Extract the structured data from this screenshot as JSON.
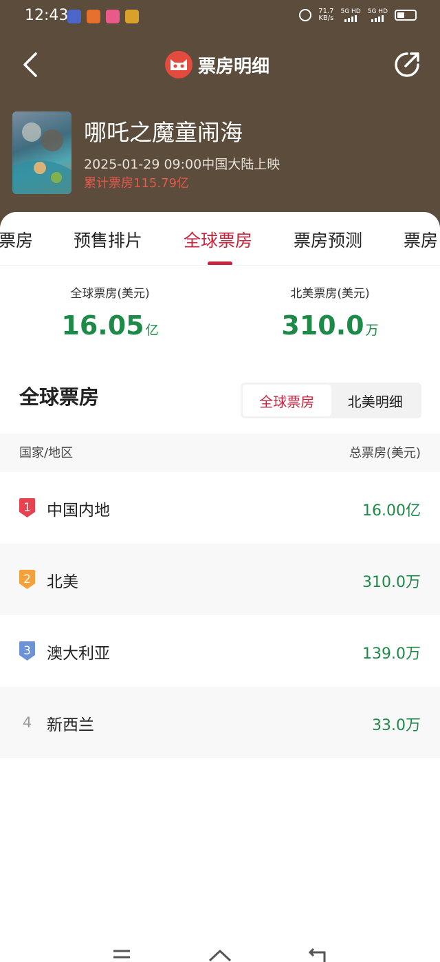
{
  "status_bar": {
    "time": "12:43",
    "net_speed": "71.7",
    "net_unit": "KB/s",
    "sim1": "5G HD",
    "sim2": "5G HD"
  },
  "header": {
    "title": "票房明细"
  },
  "movie": {
    "title": "哪吒之魔童闹海",
    "release": "2025-01-29 09:00中国大陆上映",
    "total_box": "累计票房115.79亿"
  },
  "tabs": [
    {
      "label": "票房"
    },
    {
      "label": "预售排片"
    },
    {
      "label": "全球票房"
    },
    {
      "label": "票房预测"
    },
    {
      "label": "票房"
    }
  ],
  "summary": {
    "global_label": "全球票房(美元)",
    "global_value": "16.05",
    "global_unit": "亿",
    "na_label": "北美票房(美元)",
    "na_value": "310.0",
    "na_unit": "万"
  },
  "section": {
    "title": "全球票房",
    "toggle_global": "全球票房",
    "toggle_na": "北美明细"
  },
  "table": {
    "col_region": "国家/地区",
    "col_total": "总票房(美元)",
    "rows": [
      {
        "rank": "1",
        "country": "中国内地",
        "amount": "16.00亿",
        "badge_color": "#e8414f"
      },
      {
        "rank": "2",
        "country": "北美",
        "amount": "310.0万",
        "badge_color": "#f5a03a"
      },
      {
        "rank": "3",
        "country": "澳大利亚",
        "amount": "139.0万",
        "badge_color": "#6e92d6"
      },
      {
        "rank": "4",
        "country": "新西兰",
        "amount": "33.0万"
      }
    ]
  },
  "colors": {
    "header_bg": "#5b4c3b",
    "accent": "#c7253d",
    "value_green": "#1e8a48"
  }
}
